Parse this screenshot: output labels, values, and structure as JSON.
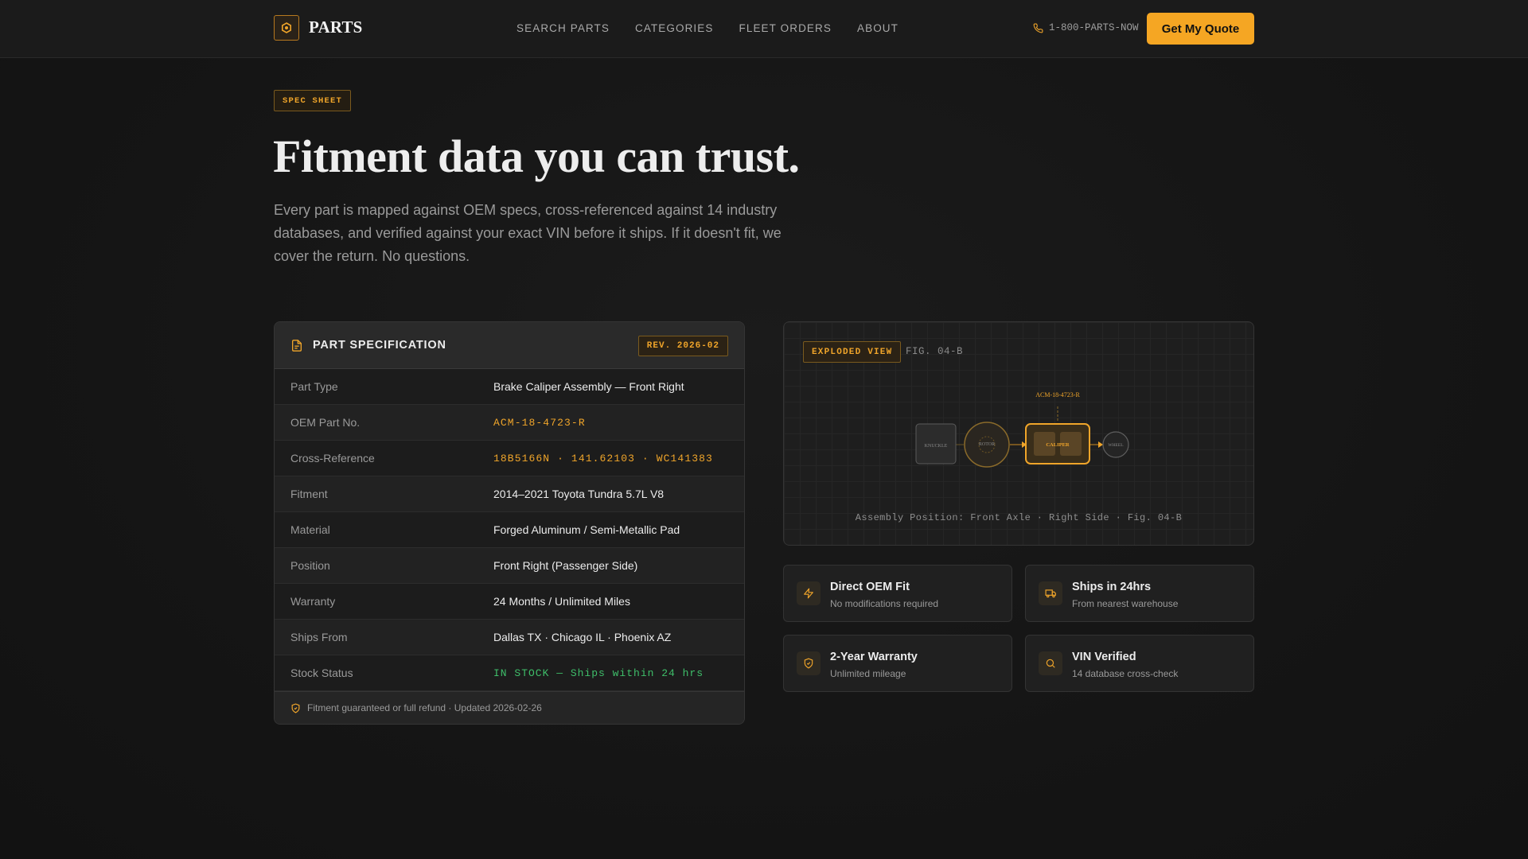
{
  "nav": {
    "brand": "PARTS",
    "links": [
      "SEARCH PARTS",
      "CATEGORIES",
      "FLEET ORDERS",
      "ABOUT"
    ],
    "phone": "1-800-PARTS-NOW",
    "cta": "Get My Quote"
  },
  "hero": {
    "badge": "SPEC SHEET",
    "title": "Fitment data you can trust.",
    "subtitle": "Every part is mapped against OEM specs, cross-referenced against 14 industry databases, and verified against your exact VIN before it ships. If it doesn't fit, we cover the return. No questions."
  },
  "spec": {
    "title": "PART SPECIFICATION",
    "revision": "REV. 2026-02",
    "rows": [
      {
        "label": "Part Type",
        "value": "Brake Caliper Assembly — Front Right"
      },
      {
        "label": "OEM Part No.",
        "value": "ACM-18-4723-R"
      },
      {
        "label": "Cross-Reference",
        "value": "18B5166N · 141.62103 · WC141383"
      },
      {
        "label": "Fitment",
        "value": "2014–2021 Toyota Tundra 5.7L V8"
      },
      {
        "label": "Material",
        "value": "Forged Aluminum / Semi-Metallic Pad"
      },
      {
        "label": "Position",
        "value": "Front Right (Passenger Side)"
      },
      {
        "label": "Warranty",
        "value": "24 Months / Unlimited Miles"
      },
      {
        "label": "Ships From",
        "value": "Dallas TX · Chicago IL · Phoenix AZ"
      },
      {
        "label": "Stock Status",
        "value": "IN STOCK — Ships within 24 hrs"
      }
    ],
    "footer": "Fitment guaranteed or full refund · Updated 2026-02-26"
  },
  "diagram": {
    "badge": "EXPLODED VIEW",
    "figure": "FIG. 04-B",
    "part_callout": "ACM-18-4723-R",
    "nodes": [
      "KNUCKLE",
      "ROTOR",
      "CALIPER",
      "WHEEL"
    ],
    "caption": "Assembly Position: Front Axle · Right Side · Fig. 04-B"
  },
  "features": [
    {
      "icon": "lightning-icon",
      "title": "Direct OEM Fit",
      "subtitle": "No modifications required"
    },
    {
      "icon": "truck-icon",
      "title": "Ships in 24hrs",
      "subtitle": "From nearest warehouse"
    },
    {
      "icon": "shield-check-icon",
      "title": "2-Year Warranty",
      "subtitle": "Unlimited mileage"
    },
    {
      "icon": "search-icon",
      "title": "VIN Verified",
      "subtitle": "14 database cross-check"
    }
  ],
  "colors": {
    "accent": "#f5a623",
    "accent_text": "#f0a52a",
    "in_stock": "#3fbf6a",
    "background": "#151515"
  }
}
